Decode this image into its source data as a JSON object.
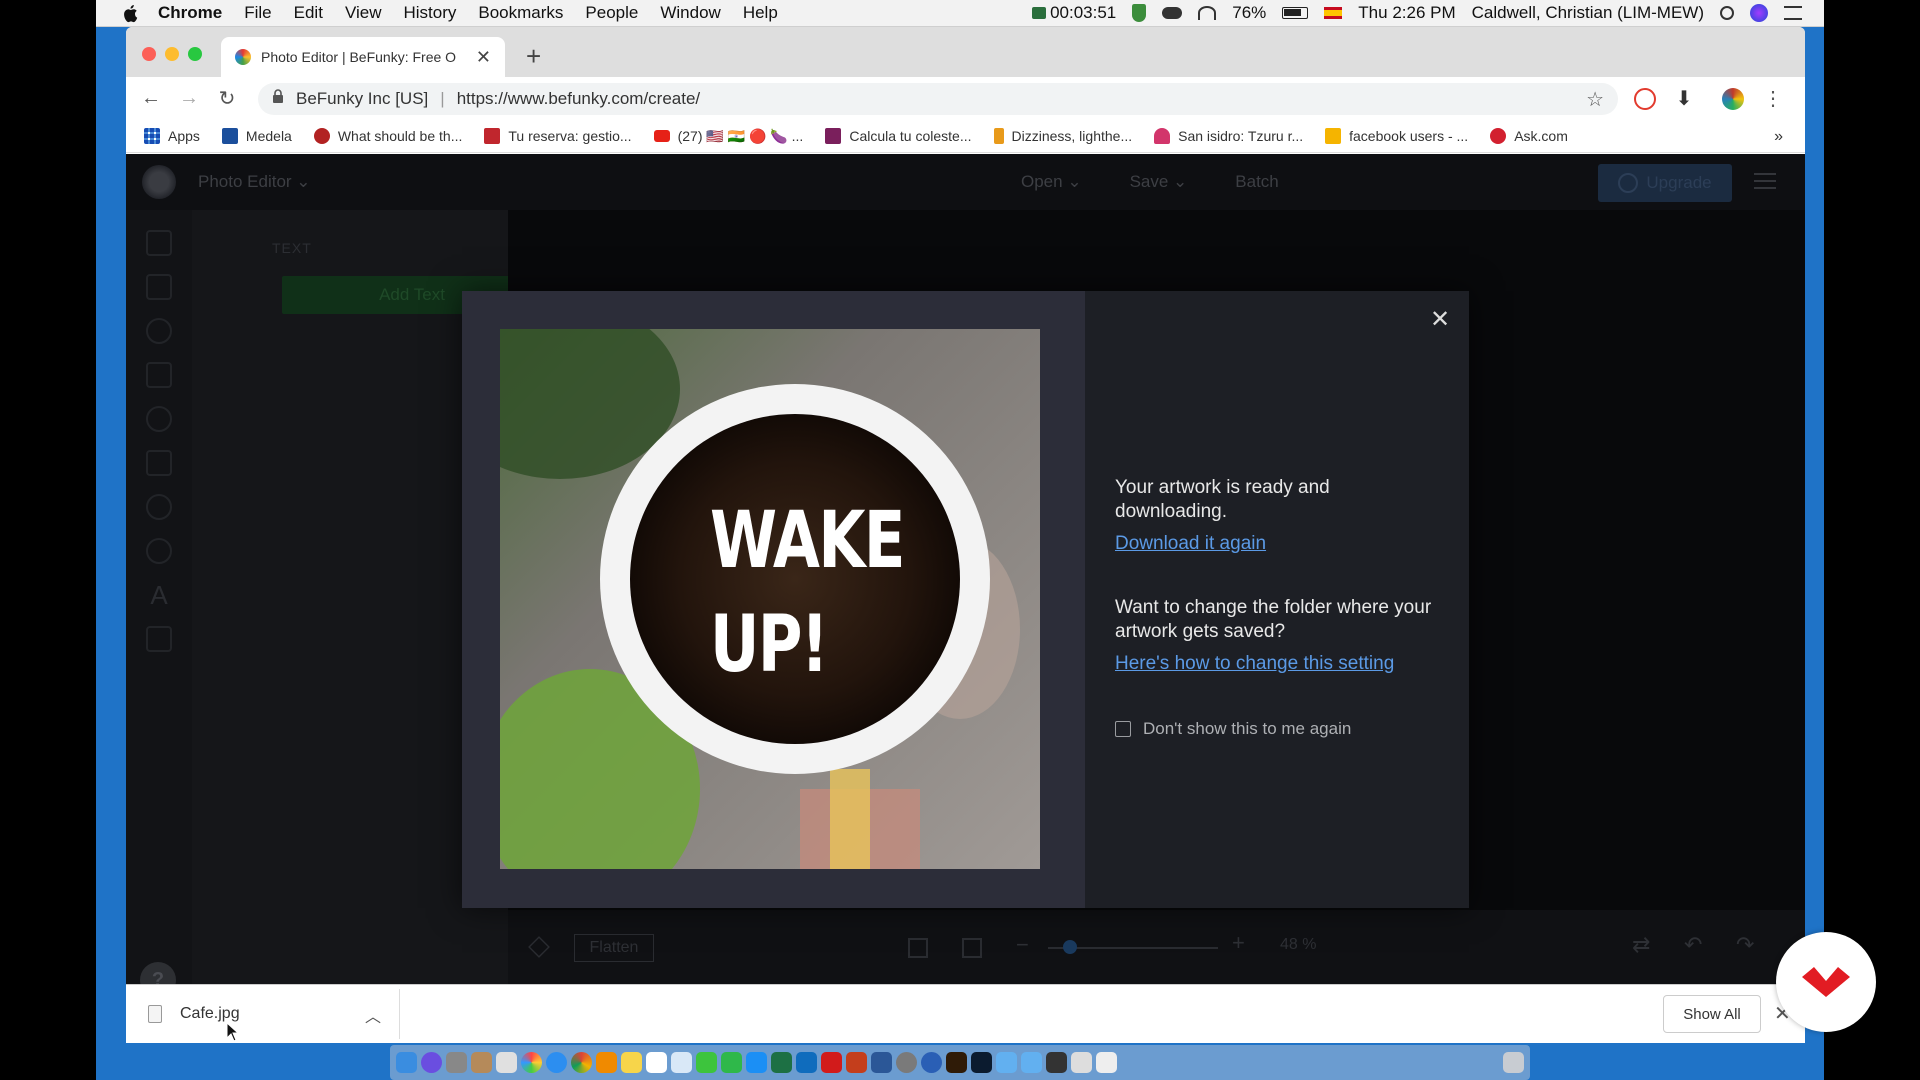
{
  "menubar": {
    "app": "Chrome",
    "items": [
      "File",
      "Edit",
      "View",
      "History",
      "Bookmarks",
      "People",
      "Window",
      "Help"
    ],
    "timer": "00:03:51",
    "battery": "76%",
    "clock": "Thu 2:26 PM",
    "user": "Caldwell, Christian (LIM-MEW)"
  },
  "browser": {
    "tab_title": "Photo Editor | BeFunky: Free O",
    "site_identity": "BeFunky Inc [US]",
    "url": "https://www.befunky.com/create/",
    "bookmarks": [
      {
        "label": "Apps",
        "color": "#4a8bd6"
      },
      {
        "label": "Medela",
        "color": "#1b4f9c"
      },
      {
        "label": "What should be th...",
        "color": "#b22222"
      },
      {
        "label": "Tu reserva: gestio...",
        "color": "#c0262d"
      },
      {
        "label": "(27) 🇺🇸 🇮🇳 🔴 🍆 ...",
        "color": "#e62117"
      },
      {
        "label": "Calcula tu coleste...",
        "color": "#7a1f5c"
      },
      {
        "label": "Dizziness, lighthe...",
        "color": "#e89a1a"
      },
      {
        "label": "San isidro: Tzuru r...",
        "color": "#d2356b"
      },
      {
        "label": "facebook users - ...",
        "color": "#f5b400"
      },
      {
        "label": "Ask.com",
        "color": "#d2202f"
      }
    ],
    "bookmarks_more": "»"
  },
  "app": {
    "product": "Photo Editor",
    "nav": [
      "Open",
      "Save",
      "Batch"
    ],
    "upgrade": "Upgrade",
    "section": "TEXT",
    "add_text": "Add Text",
    "help": "?",
    "flatten": "Flatten",
    "zoom": "48 %"
  },
  "modal": {
    "artwork_text_line1": "WAKE",
    "artwork_text_line2": "UP!",
    "ready_text": "Your artwork is ready and downloading.",
    "download_again": "Download it again",
    "folder_question": "Want to change the folder where your artwork gets saved?",
    "change_setting": "Here's how to change this setting",
    "dont_show": "Don't show this to me again",
    "dont_show_checked": false
  },
  "shelf": {
    "filename": "Cafe.jpg",
    "show_all": "Show All"
  },
  "colors": {
    "link": "#5b9ae6",
    "modal_bg": "#1d1f25",
    "badge_red": "#e21c23"
  }
}
